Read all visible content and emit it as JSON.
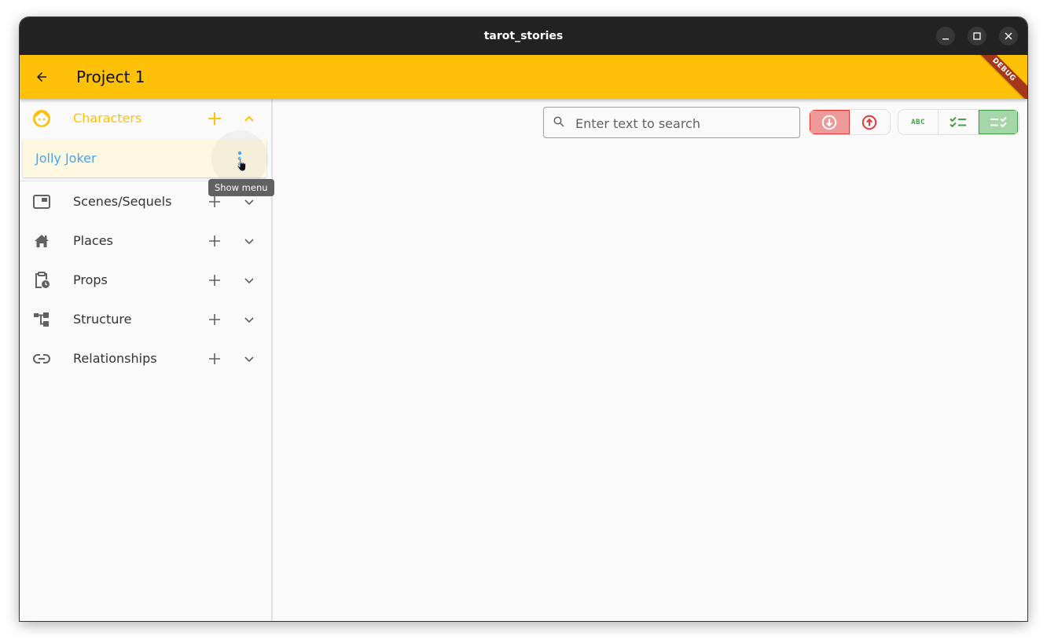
{
  "window": {
    "title": "tarot_stories",
    "controls": [
      "minimize",
      "maximize",
      "close"
    ]
  },
  "appbar": {
    "back_icon": "arrow-back-icon",
    "title": "Project 1",
    "debug_banner": "DEBUG"
  },
  "sidebar": {
    "sections": [
      {
        "label": "Characters",
        "icon": "face-icon",
        "expanded": true,
        "active": true
      },
      {
        "label": "Scenes/Sequels",
        "icon": "scene-icon",
        "expanded": false
      },
      {
        "label": "Places",
        "icon": "home-icon",
        "expanded": false
      },
      {
        "label": "Props",
        "icon": "clipboard-clock-icon",
        "expanded": false
      },
      {
        "label": "Structure",
        "icon": "account-tree-icon",
        "expanded": false
      },
      {
        "label": "Relationships",
        "icon": "link-icon",
        "expanded": false
      }
    ],
    "characters": [
      {
        "name": "Jolly Joker"
      }
    ],
    "tooltip": "Show menu"
  },
  "toolbar": {
    "search": {
      "placeholder": "Enter text to search",
      "value": ""
    },
    "sort_toggle": [
      {
        "name": "sort-descending",
        "icon": "arrow-circle-down-icon",
        "selected": true
      },
      {
        "name": "sort-ascending",
        "icon": "arrow-circle-up-icon",
        "selected": false
      }
    ],
    "view_toggle": [
      {
        "name": "abc",
        "icon": "abc-icon",
        "label": "ABC",
        "selected": false
      },
      {
        "name": "checklist",
        "icon": "checklist-icon",
        "selected": false
      },
      {
        "name": "checklist-rtl",
        "icon": "checklist-rtl-icon",
        "selected": true
      }
    ]
  },
  "colors": {
    "accent": "#ffc107",
    "titlebar": "#222222",
    "link": "#42a5f5",
    "selected_item_bg": "#fff8e1",
    "sort_red": "#e53935",
    "sort_red_bg": "#ef9a9a",
    "view_green": "#43a047",
    "view_green_bg": "#a5d6a7",
    "debug_ribbon": "#a5361a"
  }
}
